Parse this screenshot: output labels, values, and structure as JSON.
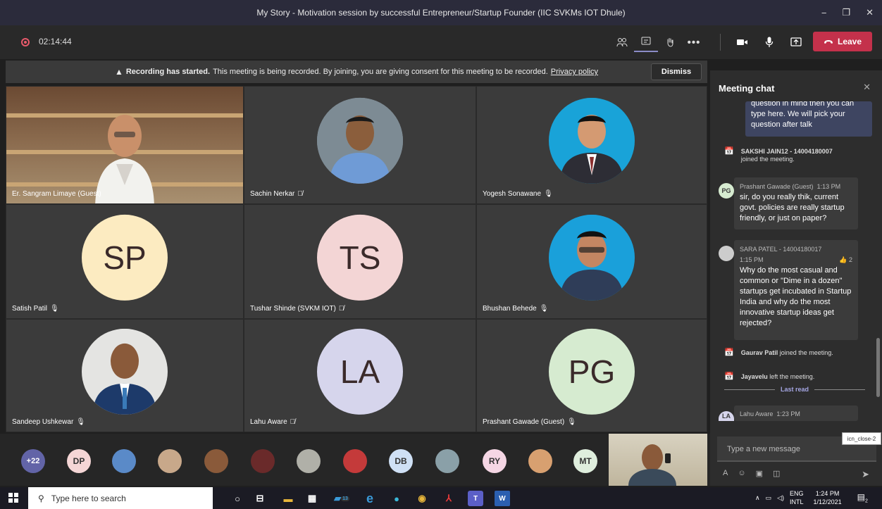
{
  "window": {
    "title": "My Story - Motivation session by successful Entrepreneur/Startup Founder (IIC SVKMs IOT Dhule)",
    "controls": [
      "−",
      "❐",
      "✕"
    ]
  },
  "toolbar": {
    "timer": "02:14:44",
    "leave_label": "Leave"
  },
  "banner": {
    "bold": "Recording has started.",
    "text": "This meeting is being recorded. By joining, you are giving consent for this meeting to be recorded.",
    "link": "Privacy policy",
    "dismiss": "Dismiss"
  },
  "participants": [
    {
      "name": "Er. Sangram Limaye (Guest)",
      "mic": ""
    },
    {
      "name": "Sachin Nerkar",
      "mic": "muted"
    },
    {
      "name": "Yogesh Sonawane",
      "mic": "on"
    },
    {
      "name": "Satish Patil",
      "mic": "on",
      "initials": "SP",
      "color": "#fcebc1"
    },
    {
      "name": "Tushar Shinde (SVKM IOT)",
      "mic": "muted",
      "initials": "TS",
      "color": "#f3d5d5"
    },
    {
      "name": "Bhushan Behede",
      "mic": "on"
    },
    {
      "name": "Sandeep Ushkewar",
      "mic": "on"
    },
    {
      "name": "Lahu Aware",
      "mic": "muted",
      "initials": "LA",
      "color": "#d6d5ec"
    },
    {
      "name": "Prashant Gawade (Guest)",
      "mic": "on",
      "initials": "PG",
      "color": "#d6ebd0"
    }
  ],
  "strip": {
    "overflow": "+22",
    "initials": [
      "DP",
      "DB",
      "RY",
      "MT"
    ]
  },
  "chat": {
    "title": "Meeting chat",
    "own_message": "question in mind then you can type here. We will pick your question after talk",
    "events": [
      {
        "name": "SAKSHI JAIN12 - 14004180007",
        "text": "joined the meeting."
      },
      {
        "name": "Gaurav Patil",
        "text": "joined the meeting."
      },
      {
        "name": "Jayavelu",
        "text": "left the meeting."
      }
    ],
    "messages": [
      {
        "initials": "PG",
        "author": "Prashant Gawade (Guest)",
        "time": "1:13 PM",
        "text": "sir, do you really thik, current govt. policies are really startup friendly, or just on paper?"
      },
      {
        "author": "SARA PATEL - 14004180017",
        "time": "1:15 PM",
        "reactions": "2",
        "text": "Why do the most casual and common or \"Dime in a dozen\" startups get incubated in Startup India and why do the most innovative startup ideas get rejected?"
      },
      {
        "initials": "LA",
        "author": "Lahu Aware",
        "time": "1:23 PM"
      }
    ],
    "last_read": "Last read",
    "compose_placeholder": "Type a new message"
  },
  "tooltip": "icn_close-2",
  "taskbar": {
    "search_placeholder": "Type here to search",
    "lang_top": "ENG",
    "lang_bottom": "INTL",
    "time": "1:24 PM",
    "date": "1/12/2021",
    "notifications": "2",
    "badge": "13"
  },
  "colors": {
    "accent": "#6264a7",
    "leave": "#c4314b",
    "recording": "#e85a6b"
  }
}
